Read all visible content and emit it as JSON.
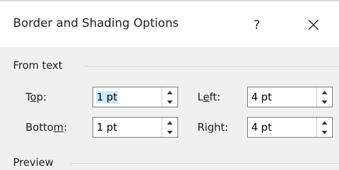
{
  "dialog": {
    "title": "Border and Shading Options",
    "help_label": "?",
    "close_icon": "close-icon"
  },
  "from_text": {
    "group_label": "From text",
    "top": {
      "label_pre": "T",
      "label_u": "o",
      "label_post": "p:",
      "value": "1 pt"
    },
    "bottom": {
      "label_pre": "Botto",
      "label_u": "m",
      "label_post": ":",
      "value": "1 pt"
    },
    "left": {
      "label_pre": "L",
      "label_u": "e",
      "label_post": "ft:",
      "value": "4 pt"
    },
    "right": {
      "label_pre": "Ri",
      "label_u": "g",
      "label_post": "ht:",
      "value": "4 pt"
    }
  },
  "preview": {
    "group_label": "Preview"
  },
  "colors": {
    "selection": "#cce8ff",
    "body_bg": "#f0f0f0"
  }
}
